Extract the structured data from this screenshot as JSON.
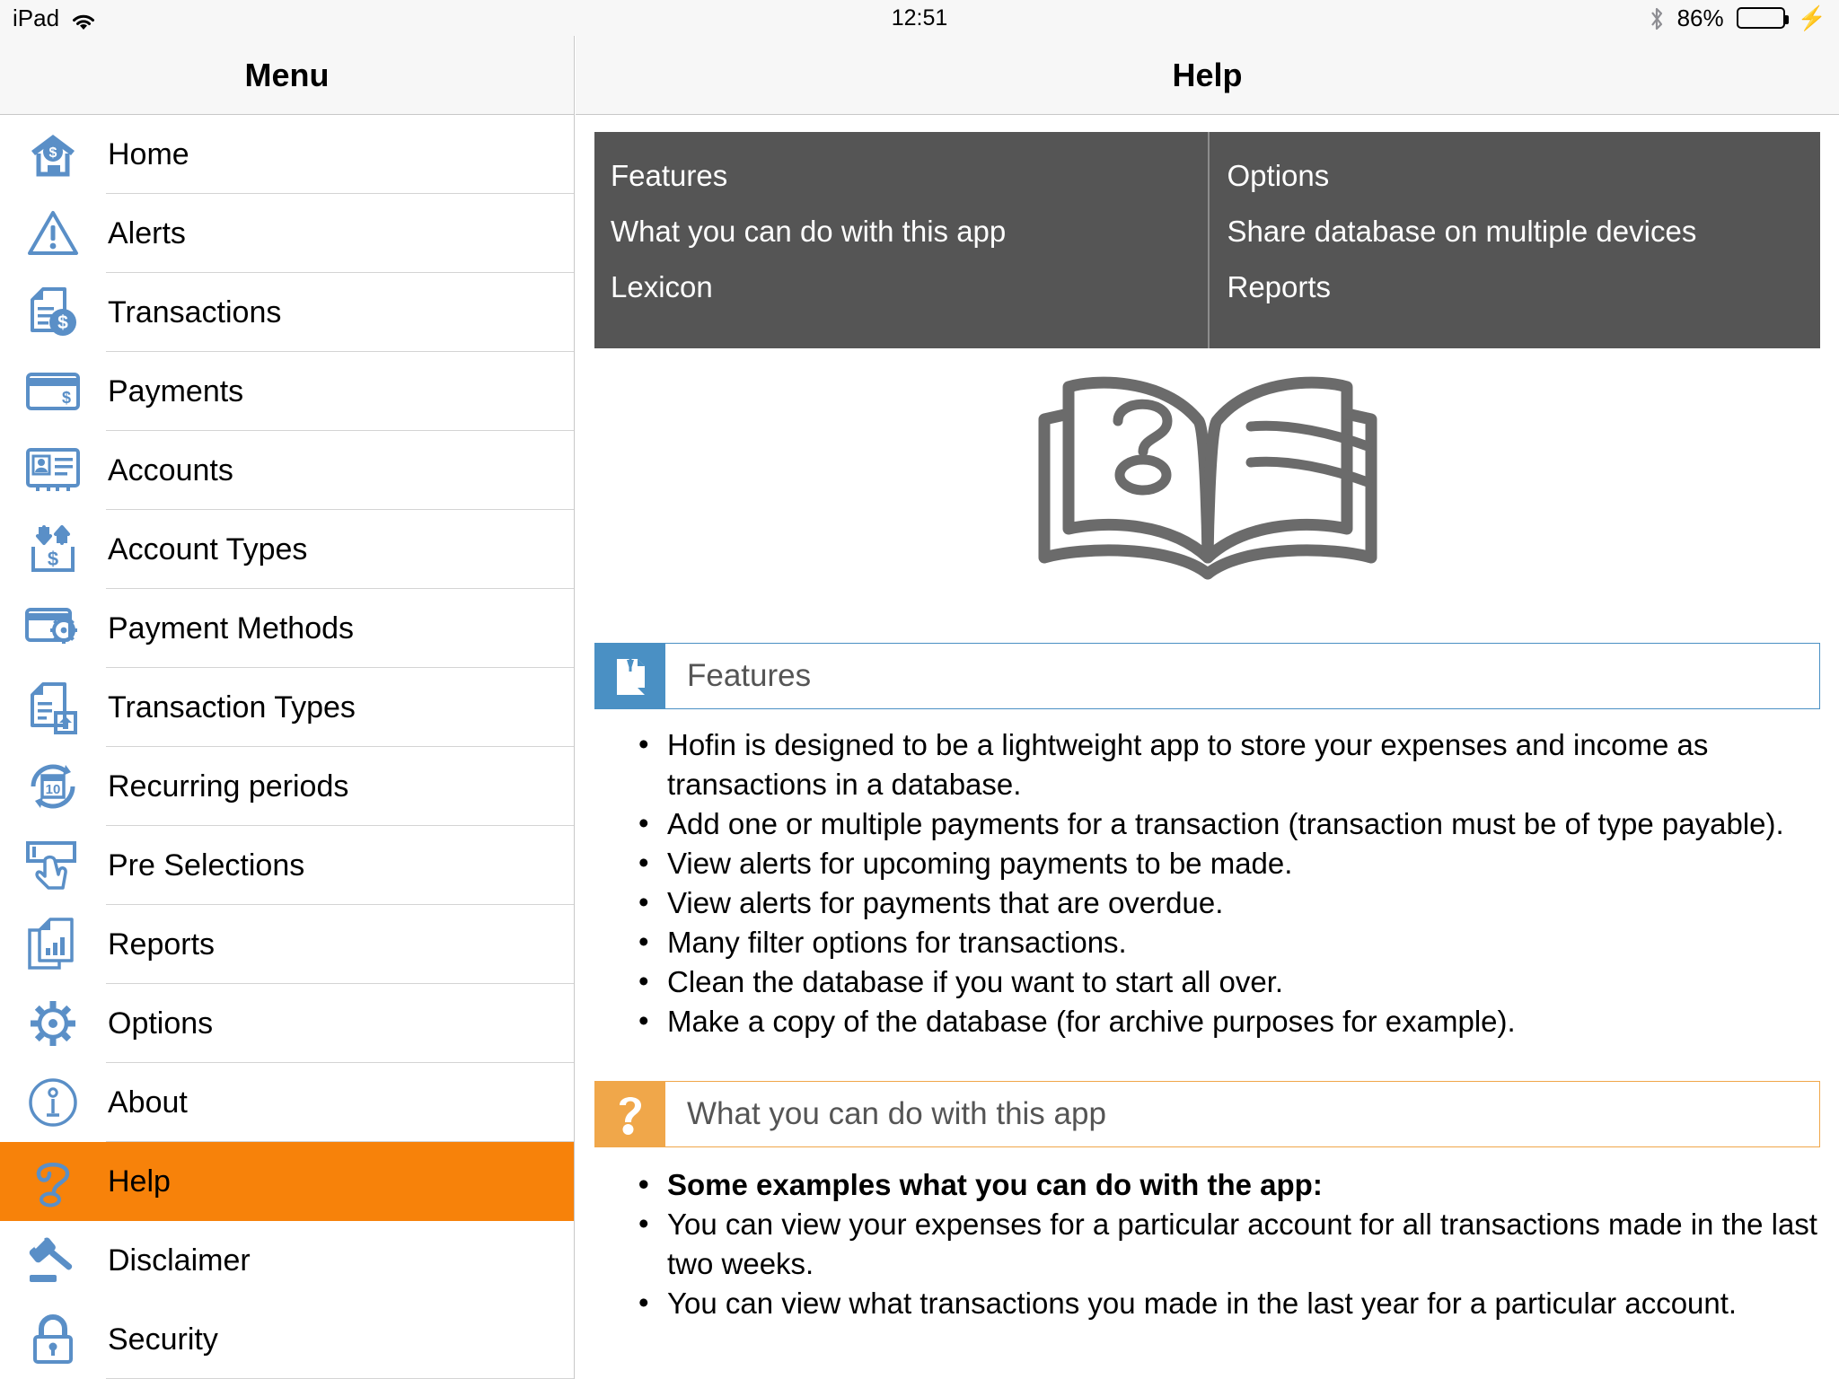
{
  "statusbar": {
    "device": "iPad",
    "wifi_icon": "wifi-icon",
    "time": "12:51",
    "bluetooth_icon": "bluetooth-icon",
    "battery_percent": "86%",
    "battery_level": 86,
    "battery_icon": "battery-icon",
    "charging_icon": "lightning-bolt-icon"
  },
  "sidebar": {
    "title": "Menu",
    "selected": "Help",
    "highlight_color": "#f7820a",
    "icon_color": "#5a8fc7",
    "items": [
      {
        "label": "Home",
        "icon": "house-dollar-icon"
      },
      {
        "label": "Alerts",
        "icon": "warning-triangle-icon"
      },
      {
        "label": "Transactions",
        "icon": "document-dollar-icon"
      },
      {
        "label": "Payments",
        "icon": "credit-card-dollar-icon"
      },
      {
        "label": "Accounts",
        "icon": "id-card-icon"
      },
      {
        "label": "Account Types",
        "icon": "arrows-inbox-dollar-icon"
      },
      {
        "label": "Payment Methods",
        "icon": "credit-card-gear-icon"
      },
      {
        "label": "Transaction Types",
        "icon": "document-house-icon"
      },
      {
        "label": "Recurring periods",
        "icon": "calendar-refresh-icon"
      },
      {
        "label": "Pre Selections",
        "icon": "hand-pointer-field-icon"
      },
      {
        "label": "Reports",
        "icon": "document-chart-icon"
      },
      {
        "label": "Options",
        "icon": "gear-icon"
      },
      {
        "label": "About",
        "icon": "info-circle-icon"
      },
      {
        "label": "Help",
        "icon": "question-mark-icon"
      },
      {
        "label": "Disclaimer",
        "icon": "gavel-icon"
      },
      {
        "label": "Security",
        "icon": "padlock-icon"
      }
    ]
  },
  "detail": {
    "title": "Help",
    "quicklinks": {
      "left": [
        "Features",
        "What you can do with this app",
        "Lexicon"
      ],
      "right": [
        "Options",
        "Share database on multiple devices",
        "Reports"
      ]
    },
    "hero_icon": "open-book-question-icon",
    "sections": [
      {
        "title": "Features",
        "badge_icon": "pinned-note-icon",
        "accent": "#4a90c4",
        "bullets": [
          {
            "text": "Hofin is designed to be a lightweight app to store your expenses and income as transactions in a database.",
            "bold": false
          },
          {
            "text": "Add one or multiple payments for a transaction (transaction must be of type payable).",
            "bold": false
          },
          {
            "text": "View alerts for upcoming payments to be made.",
            "bold": false
          },
          {
            "text": "View alerts for payments that are overdue.",
            "bold": false
          },
          {
            "text": "Many filter options for transactions.",
            "bold": false
          },
          {
            "text": "Clean the database if you want to start all over.",
            "bold": false
          },
          {
            "text": "Make a copy of the database (for archive purposes for example).",
            "bold": false
          }
        ]
      },
      {
        "title": "What you can do with this app",
        "badge_icon": "question-mark-icon",
        "accent": "#f0a74a",
        "bullets": [
          {
            "text": "Some examples what you can do with the app:",
            "bold": true
          },
          {
            "text": "You can view your expenses for a particular account for all transactions made in the last two weeks.",
            "bold": false
          },
          {
            "text": "You can view what transactions you made in the last year for a particular account.",
            "bold": false
          }
        ]
      }
    ]
  }
}
